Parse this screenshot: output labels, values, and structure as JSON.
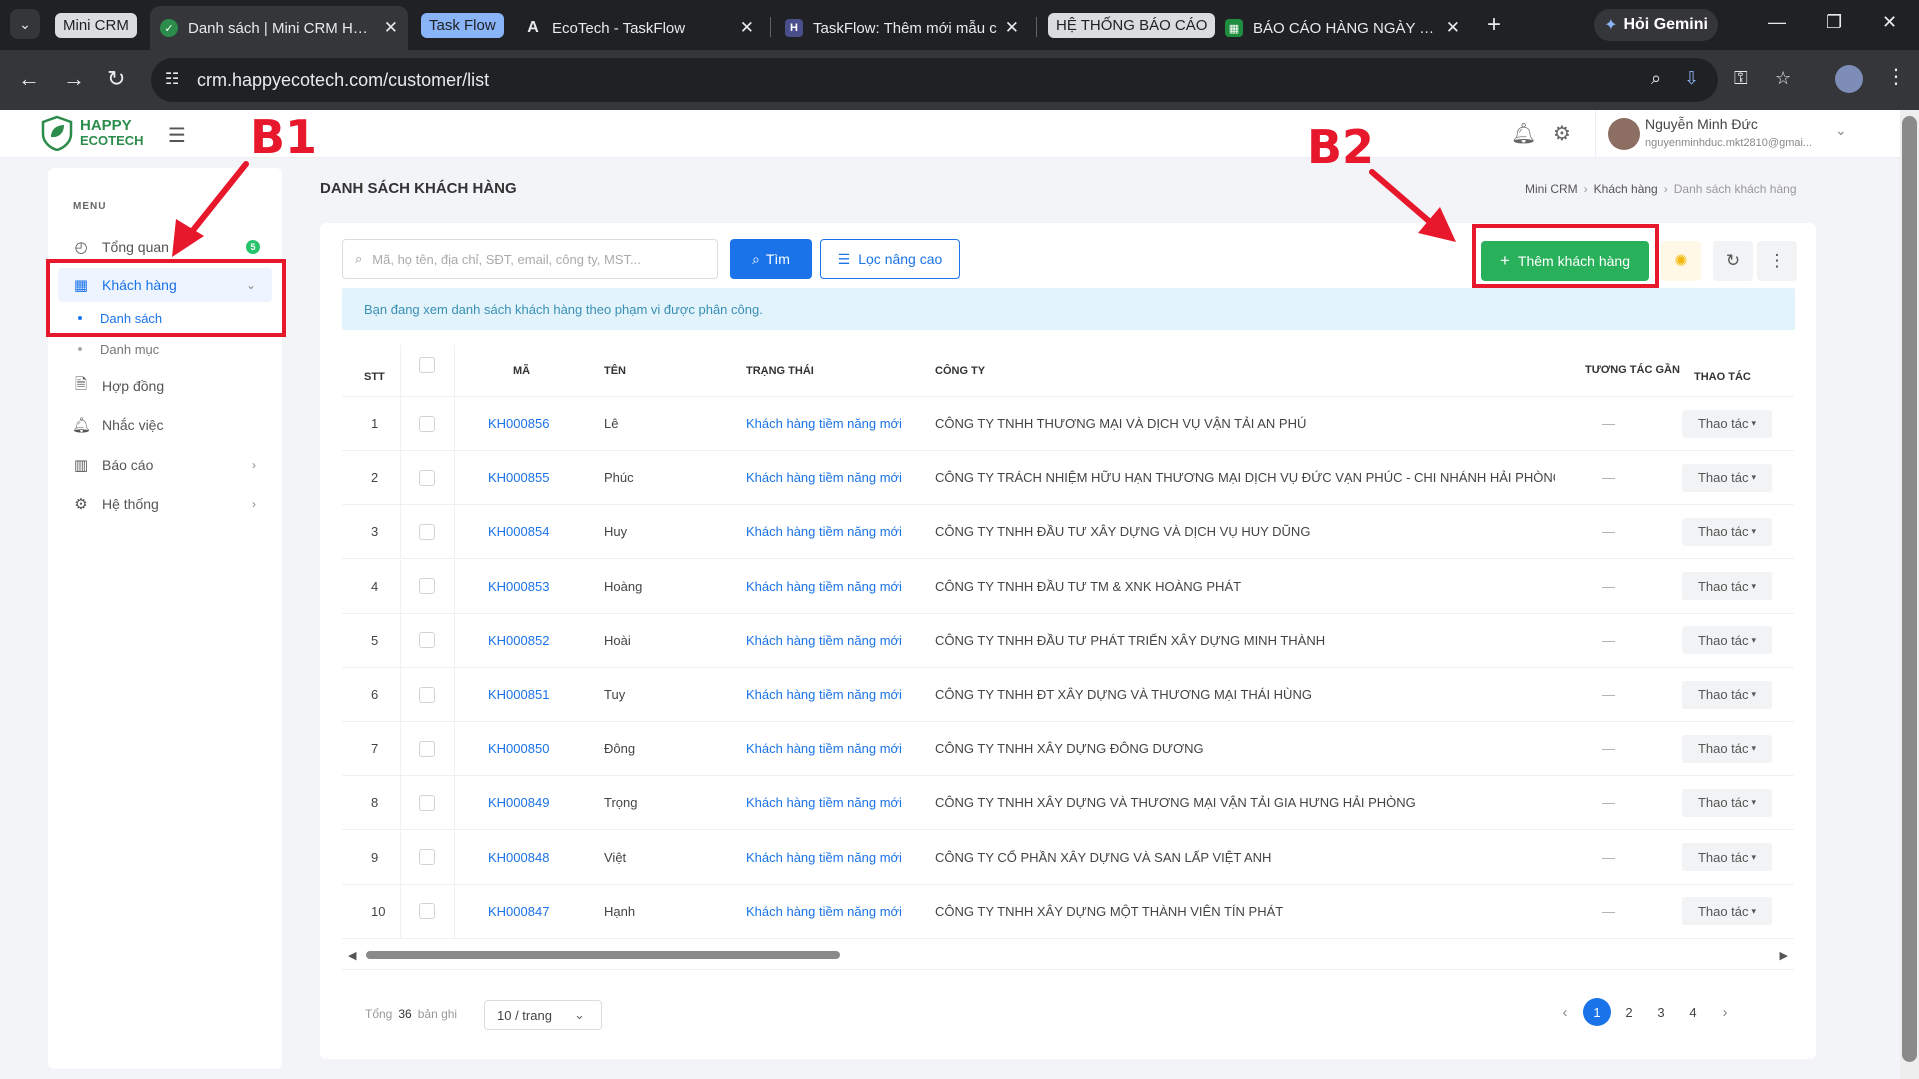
{
  "browser": {
    "tab_groups": [
      {
        "label": "Mini CRM",
        "bg": "#dadce0",
        "fg": "#202124"
      },
      {
        "label": "Task Flow",
        "bg": "#8ab4f8",
        "fg": "#202124"
      },
      {
        "label": "HỆ THỐNG BÁO CÁO",
        "bg": "#dadce0",
        "fg": "#202124"
      }
    ],
    "tabs": [
      {
        "title": "Danh sách | Mini CRM Happy",
        "icon": "happy-ecotech-favicon",
        "active": true
      },
      {
        "title": "EcoTech - TaskFlow",
        "icon": "a-favicon"
      },
      {
        "title": "TaskFlow: Thêm mới mẫu c",
        "icon": "h-favicon"
      },
      {
        "title": "BÁO CÁO HÀNG NGÀY TE",
        "icon": "sheets-favicon"
      }
    ],
    "gemini_label": "Hỏi Gemini",
    "url": "crm.happyecotech.com/customer/list"
  },
  "app": {
    "logo_line1": "HAPPY",
    "logo_line2": "ECOTECH",
    "brand_color": "#2c8c4c",
    "user": {
      "name": "Nguyễn Minh Đức",
      "email": "nguyenminhduc.mkt2810@gmai..."
    }
  },
  "sidebar": {
    "menu_title": "MENU",
    "items": [
      {
        "label": "Tổng quan",
        "icon": "dashboard-icon",
        "badge": "5"
      },
      {
        "label": "Khách hàng",
        "icon": "customers-icon",
        "active": true
      },
      {
        "label": "Hợp đồng",
        "icon": "contract-icon"
      },
      {
        "label": "Nhắc việc",
        "icon": "bell-icon"
      },
      {
        "label": "Báo cáo",
        "icon": "chart-icon"
      },
      {
        "label": "Hệ thống",
        "icon": "gear-icon"
      }
    ],
    "sub_items": [
      {
        "label": "Danh sách",
        "active": true
      },
      {
        "label": "Danh mục"
      }
    ]
  },
  "page": {
    "title": "DANH SÁCH KHÁCH HÀNG",
    "breadcrumb": [
      "Mini CRM",
      "Khách hàng",
      "Danh sách khách hàng"
    ]
  },
  "toolbar": {
    "search_placeholder": "Mã, họ tên, địa chỉ, SĐT, email, công ty, MST...",
    "search_label": "Tìm",
    "filter_label": "Lọc nâng cao",
    "add_label": "Thêm khách hàng"
  },
  "info_message": "Bạn đang xem danh sách khách hàng theo phạm vi được phân công.",
  "table": {
    "columns": {
      "stt": "STT",
      "code": "MÃ",
      "name": "TÊN",
      "status": "TRẠNG THÁI",
      "company": "CÔNG TY",
      "interaction": "TƯƠNG TÁC GẦN",
      "actions": "THAO TÁC"
    },
    "rows": [
      {
        "stt": "1",
        "code": "KH000856",
        "name": "Lê",
        "status": "Khách hàng tiềm năng mới",
        "company": "CÔNG TY TNHH THƯƠNG MẠI VÀ DỊCH VỤ VẬN TẢI AN PHÚ",
        "interaction": "—",
        "action": "Thao tác"
      },
      {
        "stt": "2",
        "code": "KH000855",
        "name": "Phúc",
        "status": "Khách hàng tiềm năng mới",
        "company": "CÔNG TY TRÁCH NHIỆM HỮU HẠN THƯƠNG MẠI DỊCH VỤ ĐỨC VẠN PHÚC - CHI NHÁNH HẢI PHÒNG",
        "interaction": "—",
        "action": "Thao tác"
      },
      {
        "stt": "3",
        "code": "KH000854",
        "name": "Huy",
        "status": "Khách hàng tiềm năng mới",
        "company": "CÔNG TY TNHH ĐẦU TƯ XÂY DỰNG VÀ DỊCH VỤ HUY DŨNG",
        "interaction": "—",
        "action": "Thao tác"
      },
      {
        "stt": "4",
        "code": "KH000853",
        "name": "Hoàng",
        "status": "Khách hàng tiềm năng mới",
        "company": "CÔNG TY TNHH ĐẦU TƯ TM & XNK HOÀNG PHÁT",
        "interaction": "—",
        "action": "Thao tác"
      },
      {
        "stt": "5",
        "code": "KH000852",
        "name": "Hoài",
        "status": "Khách hàng tiềm năng mới",
        "company": "CÔNG TY TNHH ĐẦU TƯ PHÁT TRIỂN XÂY DỰNG MINH THÀNH",
        "interaction": "—",
        "action": "Thao tác"
      },
      {
        "stt": "6",
        "code": "KH000851",
        "name": "Tuy",
        "status": "Khách hàng tiềm năng mới",
        "company": "CÔNG TY TNHH ĐT XÂY DỰNG VÀ THƯƠNG MẠI THÁI HÙNG",
        "interaction": "—",
        "action": "Thao tác"
      },
      {
        "stt": "7",
        "code": "KH000850",
        "name": "Đông",
        "status": "Khách hàng tiềm năng mới",
        "company": "CÔNG TY TNHH XÂY DỰNG ĐÔNG DƯƠNG",
        "interaction": "—",
        "action": "Thao tác"
      },
      {
        "stt": "8",
        "code": "KH000849",
        "name": "Trọng",
        "status": "Khách hàng tiềm năng mới",
        "company": "CÔNG TY TNHH XÂY DỰNG VÀ THƯƠNG MẠI VẬN TẢI GIA HƯNG HẢI PHÒNG",
        "interaction": "—",
        "action": "Thao tác"
      },
      {
        "stt": "9",
        "code": "KH000848",
        "name": "Việt",
        "status": "Khách hàng tiềm năng mới",
        "company": "CÔNG TY CỔ PHẦN XÂY DỰNG VÀ SAN LẤP VIỆT ANH",
        "interaction": "—",
        "action": "Thao tác"
      },
      {
        "stt": "10",
        "code": "KH000847",
        "name": "Hạnh",
        "status": "Khách hàng tiềm năng mới",
        "company": "CÔNG TY TNHH XÂY DỰNG MỘT THÀNH VIÊN TÍN PHÁT",
        "interaction": "—",
        "action": "Thao tác"
      }
    ]
  },
  "footer": {
    "total_prefix": "Tổng",
    "total_count": "36",
    "total_suffix": "bản ghi",
    "per_page": "10 / trang",
    "pages": [
      "1",
      "2",
      "3",
      "4"
    ],
    "current_page": "1"
  },
  "annotations": {
    "b1": "B1",
    "b2": "B2",
    "color": "#e8182c"
  }
}
